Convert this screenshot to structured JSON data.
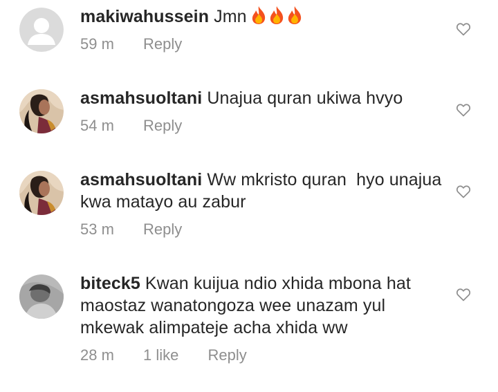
{
  "comments": [
    {
      "username": "makiwahussein",
      "text": "Jmn",
      "emoji": [
        "fire-emoji",
        "fire-emoji",
        "fire-emoji"
      ],
      "time": "59 m",
      "reply_label": "Reply",
      "avatar": "default-avatar"
    },
    {
      "username": "asmahsuoltani",
      "text": "Unajua quran ukiwa hvyo",
      "time": "54 m",
      "reply_label": "Reply",
      "avatar": "photo-avatar"
    },
    {
      "username": "asmahsuoltani",
      "text": "Ww mkristo quran  hyo unajua kwa matayo au zabur",
      "time": "53 m",
      "reply_label": "Reply",
      "avatar": "photo-avatar"
    },
    {
      "username": "biteck5",
      "text": "Kwan kuijua ndio xhida mbona hat maostaz wanatongoza wee unazam yul mkewak alimpateje acha xhida ww",
      "time": "28 m",
      "likes": "1 like",
      "reply_label": "Reply",
      "avatar": "photo-avatar"
    }
  ],
  "icons": {
    "like": "heart-outline-icon"
  },
  "colors": {
    "text": "#262626",
    "meta": "#8e8e8e",
    "heart_outline": "#8e8e8e"
  }
}
